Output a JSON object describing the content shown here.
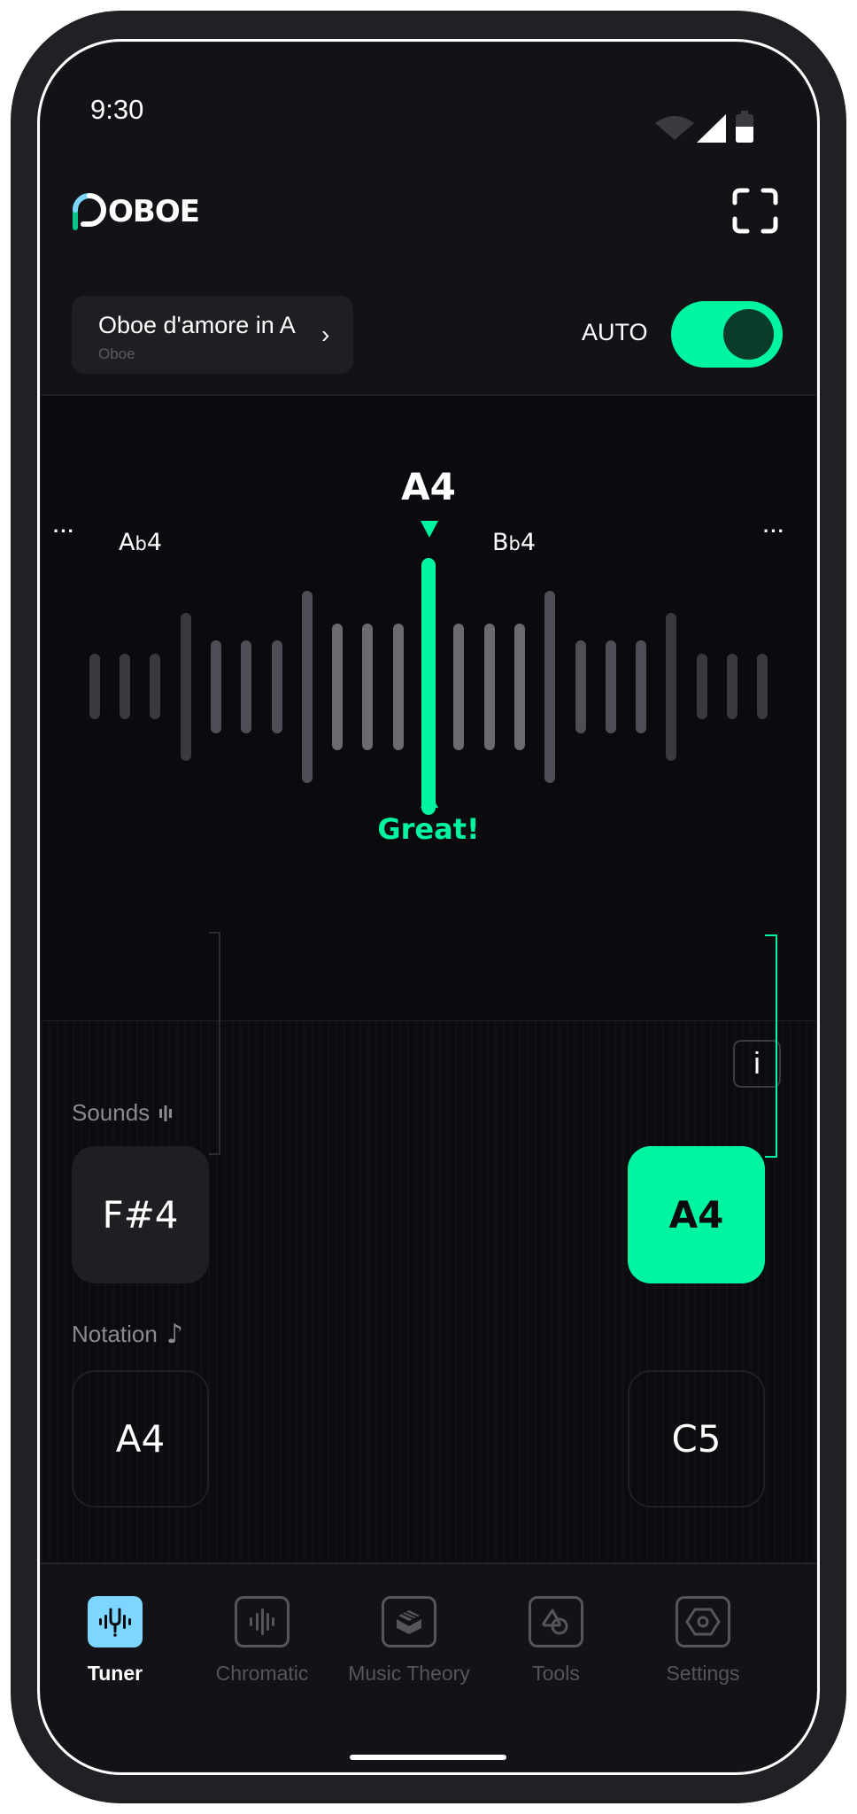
{
  "status_bar": {
    "time": "9:30",
    "icons": [
      "wifi-icon",
      "signal-icon",
      "battery-icon"
    ]
  },
  "header": {
    "app_name": "OBOE",
    "fullscreen_icon": "fullscreen-icon"
  },
  "instrument": {
    "name": "Oboe d'amore in A",
    "family": "Oboe",
    "chevron": "›"
  },
  "auto_mode": {
    "label": "AUTO",
    "enabled": true
  },
  "tuner": {
    "target_note": "A4",
    "prev_note": {
      "letter": "A",
      "accidental": "b",
      "octave": "4"
    },
    "next_note": {
      "letter": "B",
      "accidental": "b",
      "octave": "4"
    },
    "more_left": "···",
    "more_right": "···",
    "feedback": "Great!",
    "cents_offset": 0,
    "accent_color": "#00f5a0"
  },
  "transposition": {
    "info_label": "i",
    "sounds_label": "Sounds",
    "notation_label": "Notation",
    "notation_icon": "♪",
    "left": {
      "sounds": "F#4",
      "notation": "A4"
    },
    "right": {
      "sounds": "A4",
      "notation": "C5"
    },
    "active_side": "right"
  },
  "nav": {
    "items": [
      {
        "label": "Tuner",
        "icon": "tuning-fork-icon",
        "active": true
      },
      {
        "label": "Chromatic",
        "icon": "waveform-icon",
        "active": false
      },
      {
        "label": "Music Theory",
        "icon": "book-stack-icon",
        "active": false
      },
      {
        "label": "Tools",
        "icon": "shapes-icon",
        "active": false
      },
      {
        "label": "Settings",
        "icon": "hex-nut-icon",
        "active": false
      }
    ],
    "active_color": "#7dd6ff"
  }
}
